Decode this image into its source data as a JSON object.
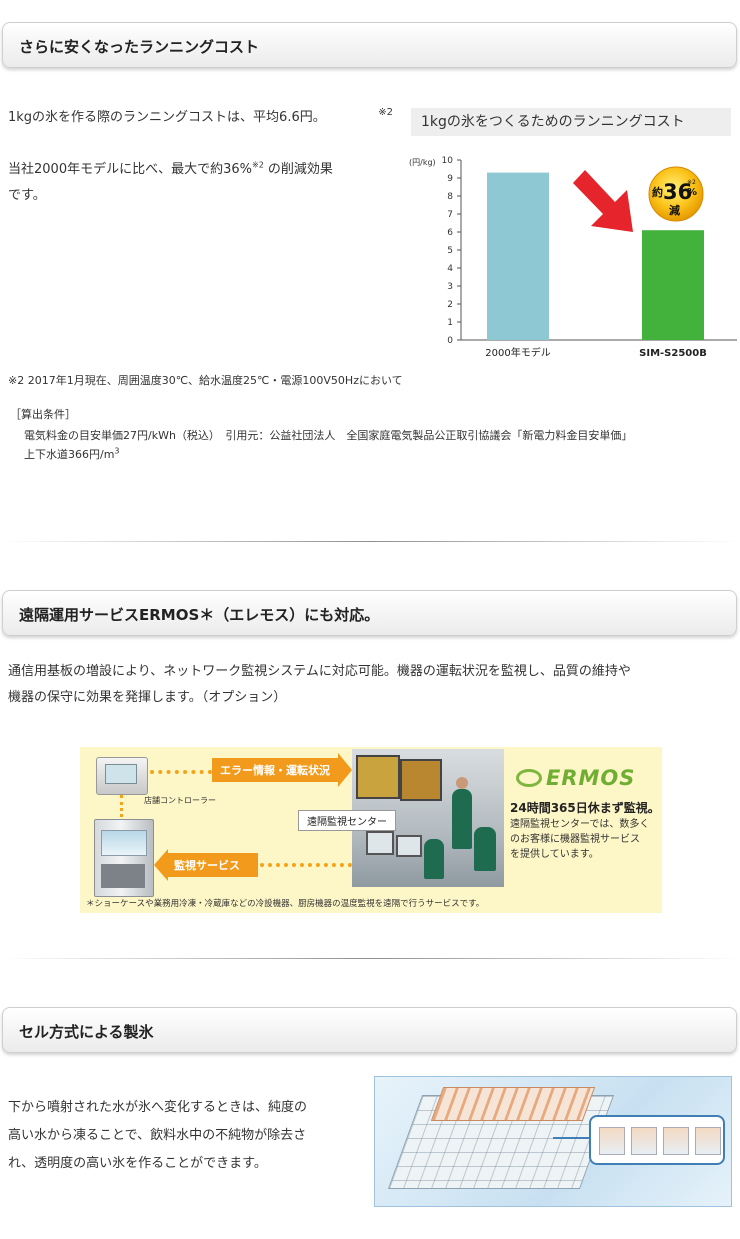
{
  "section1": {
    "title": "さらに安くなったランニングコスト",
    "line1a": "1kgの氷を作る際のランニングコストは、平均6.6円。",
    "line1_note": "※2",
    "line2a": "当社2000年モデルに比べ、最大で約36%",
    "line2_note": "※2",
    "line2b": "の削減効果",
    "line3": "です。",
    "footnote": "※2 2017年1月現在、周囲温度30℃、給水温度25℃・電源100V50Hzにおいて",
    "calc_title": "［算出条件］",
    "calc_line1": "電気料金の目安単価27円/kWh（税込）　引用元：公益社団法人　全国家庭電気製品公正取引協議会「新電力料金目安単価」",
    "calc_line2a": "上下水道366円/m",
    "calc_line2_sup": "3"
  },
  "chart_data": {
    "type": "bar",
    "title": "1kgの氷をつくるためのランニングコスト",
    "ylabel": "(円/kg)",
    "ylim": [
      0,
      10
    ],
    "yticks": [
      "0",
      "1",
      "2",
      "3",
      "4",
      "5",
      "6",
      "7",
      "8",
      "9",
      "10"
    ],
    "categories": [
      "2000年モデル",
      "SIM-S2500B"
    ],
    "values": [
      9.3,
      6.1
    ],
    "colors": [
      "#8ec8d2",
      "#43b23c"
    ],
    "badge": {
      "prefix": "約",
      "value": "36",
      "percent": "%",
      "note": "※2",
      "suffix": "減"
    },
    "grid": false
  },
  "section2": {
    "title": "遠隔運用サービスERMOS＊（エレモス）にも対応。",
    "line1": "通信用基板の増設により、ネットワーク監視システムに対応可能。機器の運転状況を監視し、品質の維持や",
    "line2": "機器の保守に効果を発揮します。（オプション）",
    "banner": {
      "error_label": "エラー情報・運転状況",
      "service_label": "監視サービス",
      "controller_label": "店舗コントローラー",
      "center_label": "遠隔監視センター",
      "logo": "ERMOS",
      "headline": "24時間365日休まず監視。",
      "desc1": "遠隔監視センターでは、数多く",
      "desc2": "のお客様に機器監視サービス",
      "desc3": "を提供しています。",
      "note": "＊ショーケースや業務用冷凍・冷蔵庫などの冷設機器、厨房機器の温度監視を遠隔で行うサービスです。"
    }
  },
  "section3": {
    "title": "セル方式による製氷",
    "line1": "下から噴射された水が氷へ変化するときは、純度の",
    "line2": "高い水から凍ることで、飲料水中の不純物が除去さ",
    "line3": "れ、透明度の高い氷を作ることができます。"
  }
}
